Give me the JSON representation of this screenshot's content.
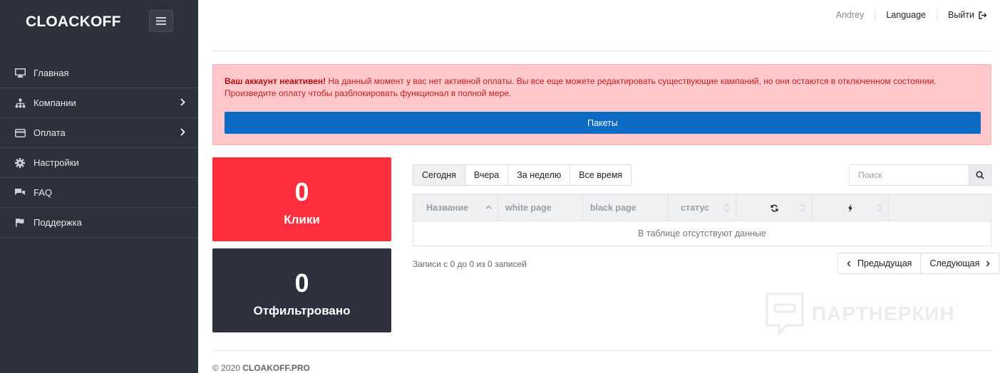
{
  "brand": "CLOACKOFF",
  "sidebar": {
    "items": [
      {
        "label": "Главная",
        "icon": "monitor-icon",
        "has_children": false
      },
      {
        "label": "Компании",
        "icon": "sitemap-icon",
        "has_children": true
      },
      {
        "label": "Оплата",
        "icon": "credit-card-icon",
        "has_children": true
      },
      {
        "label": "Настройки",
        "icon": "gear-icon",
        "has_children": false
      },
      {
        "label": "FAQ",
        "icon": "comments-icon",
        "has_children": false
      },
      {
        "label": "Поддержка",
        "icon": "flag-icon",
        "has_children": false
      }
    ]
  },
  "topbar": {
    "user": "Andrey",
    "language": "Language",
    "logout": "Выйти"
  },
  "alert": {
    "strong": "Ваш аккаунт неактивен!",
    "text": " На данный момент у вас нет активной оплаты. Вы все еще можете редактировать существующие кампаний, но они остаются в отключенном состоянии. Произведите оплату чтобы разблокировать функционал в полной мере.",
    "button": "Пакеты"
  },
  "stats": {
    "clicks": {
      "value": "0",
      "label": "Клики"
    },
    "filtered": {
      "value": "0",
      "label": "Отфильтровано"
    }
  },
  "tabs": [
    "Сегодня",
    "Вчера",
    "За неделю",
    "Все время"
  ],
  "search": {
    "placeholder": "Поиск"
  },
  "table": {
    "columns": [
      "Название",
      "white page",
      "black page",
      "статус"
    ],
    "empty": "В таблице отсутствуют данные"
  },
  "pagination": {
    "info": "Записи с 0 до 0 из 0 записей",
    "prev": "Предыдущая",
    "next": "Следующая"
  },
  "watermark": "ПАРТНЕРКИН",
  "footer": {
    "prefix": "© 2020 ",
    "brand": "CLOAKOFF.PRO"
  },
  "colors": {
    "sidebar": "#2d313c",
    "accent_blue": "#0a6ac4",
    "danger": "#ff2e3e",
    "alert_bg": "#ffc9cb"
  }
}
